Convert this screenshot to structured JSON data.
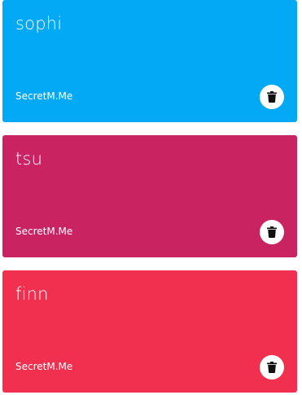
{
  "cards": [
    {
      "name": "sophi",
      "brand": "SecretM.Me",
      "color": "#03A9F4",
      "action": "trash-icon"
    },
    {
      "name": "tsu",
      "brand": "SecretM.Me",
      "color": "#C92362",
      "action": "trash-icon"
    },
    {
      "name": "finn",
      "brand": "SecretM.Me",
      "color": "#F12F4E",
      "action": "trash-icon"
    }
  ]
}
